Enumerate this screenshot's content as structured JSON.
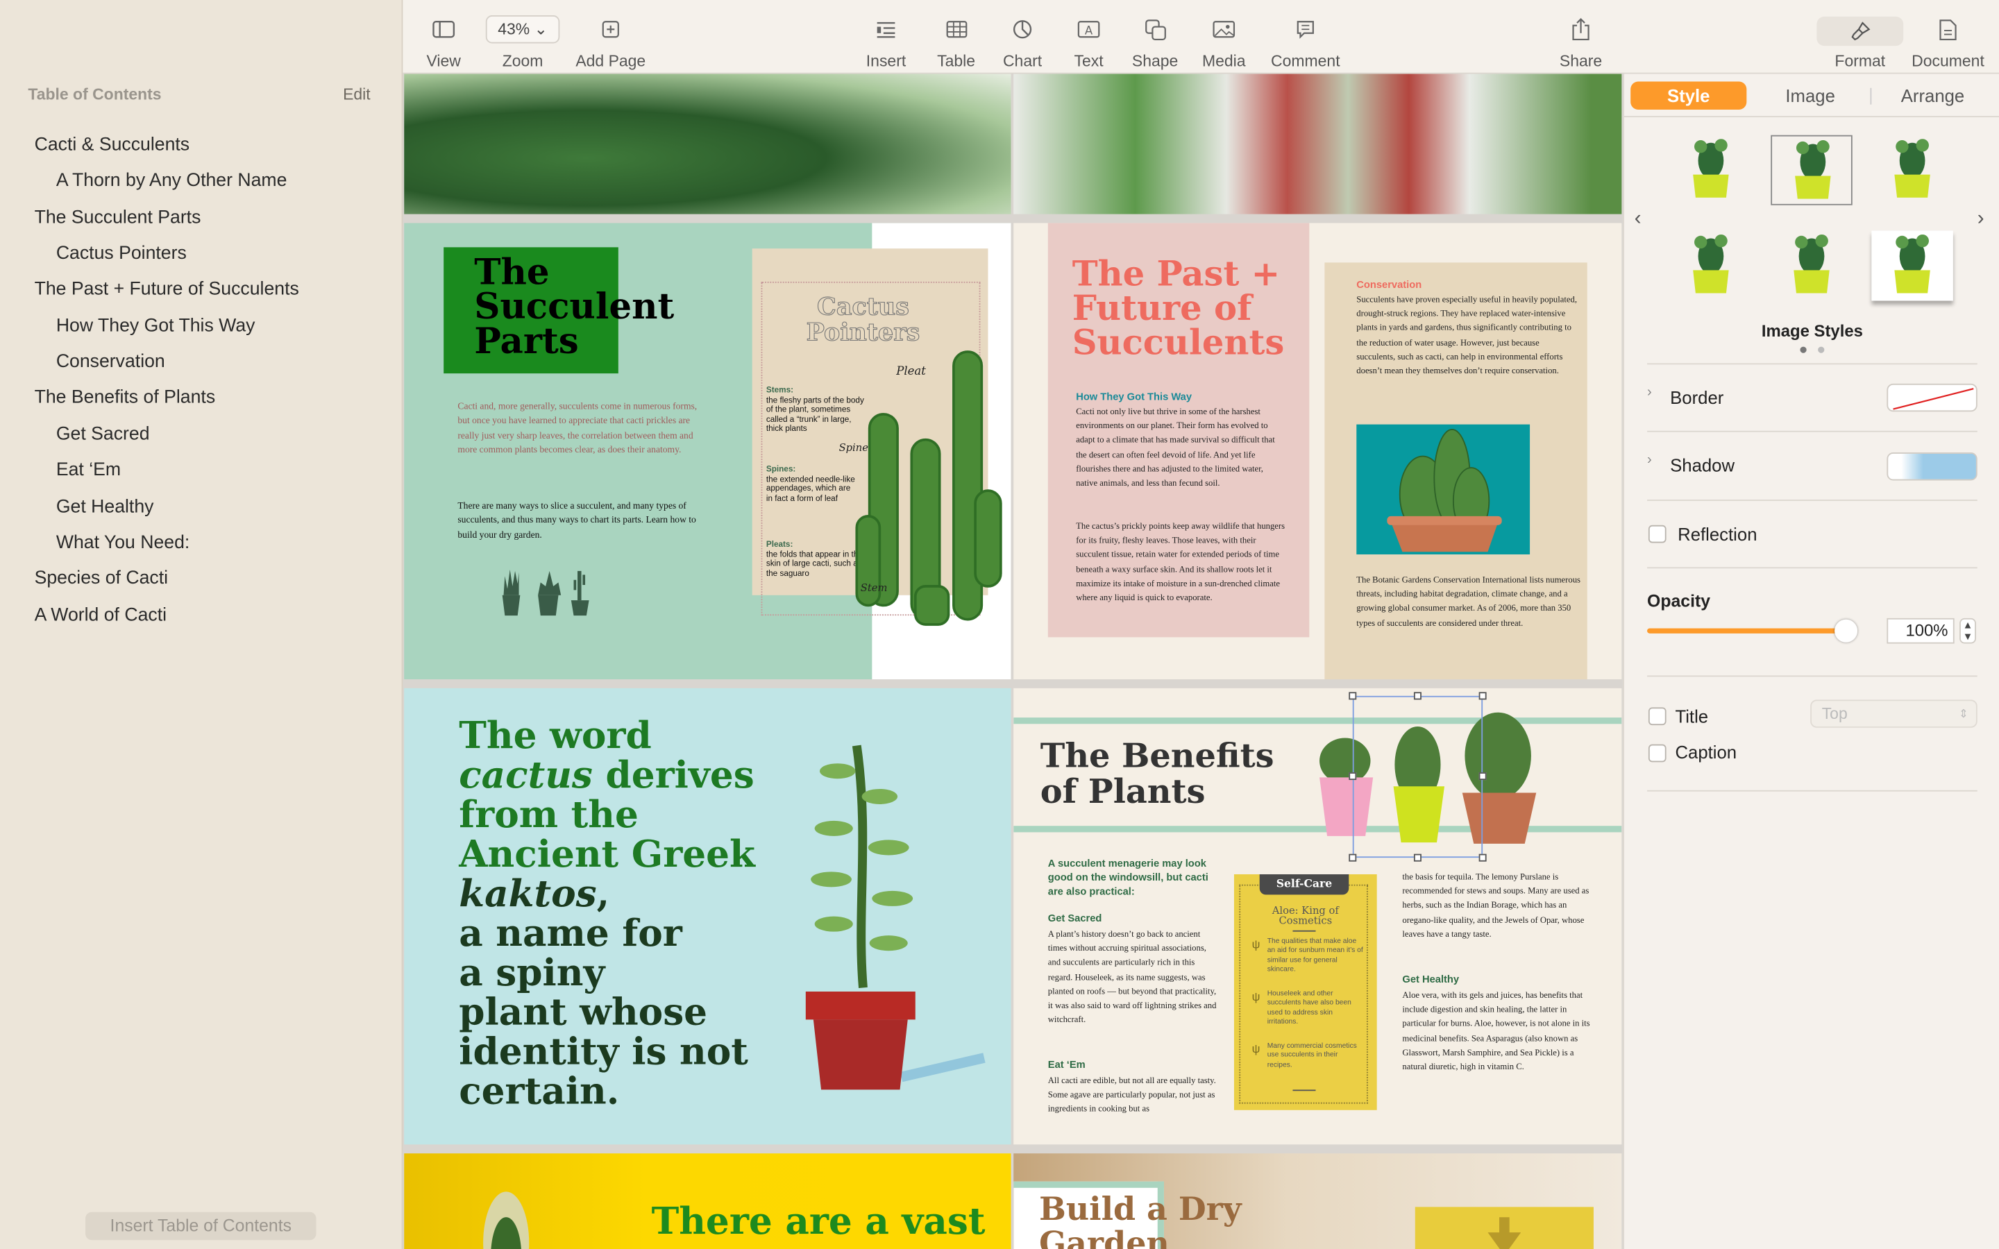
{
  "sidebar": {
    "header": "Table of Contents",
    "edit_label": "Edit",
    "items": [
      {
        "label": "Cacti & Succulents",
        "level": 1
      },
      {
        "label": "A Thorn by Any Other Name",
        "level": 2
      },
      {
        "label": "The Succulent Parts",
        "level": 1
      },
      {
        "label": "Cactus  Pointers",
        "level": 2
      },
      {
        "label": "The Past + Future of Succulents",
        "level": 1
      },
      {
        "label": "How They Got This Way",
        "level": 2
      },
      {
        "label": "Conservation",
        "level": 2
      },
      {
        "label": "The Benefits  of Plants",
        "level": 1
      },
      {
        "label": "Get Sacred",
        "level": 2
      },
      {
        "label": "Eat ‘Em",
        "level": 2
      },
      {
        "label": "Get Healthy",
        "level": 2
      },
      {
        "label": "What You Need:",
        "level": 2
      },
      {
        "label": "Species of Cacti",
        "level": 1
      },
      {
        "label": "A World of Cacti",
        "level": 1
      }
    ],
    "insert_button": "Insert Table of Contents"
  },
  "toolbar": {
    "view": "View",
    "zoom_value": "43%",
    "zoom": "Zoom",
    "add_page": "Add Page",
    "insert": "Insert",
    "table": "Table",
    "chart": "Chart",
    "text": "Text",
    "shape": "Shape",
    "media": "Media",
    "comment": "Comment",
    "share": "Share",
    "format": "Format",
    "document": "Document"
  },
  "pages": {
    "succulent_parts": {
      "title": "The Succulent Parts",
      "intro": "Cacti and, more generally, succulents come in numerous forms, but once you have learned to appreciate that cacti prickles are really just very sharp leaves, the correlation between them and more common plants becomes clear, as does their anatomy.",
      "body": "There are many ways to slice a succulent, and many types of succulents, and thus many ways to chart its parts. Learn how to build your dry garden.",
      "pointers_title": "Cactus Pointers",
      "stems_h": "Stems:",
      "stems": "the fleshy parts of the body of the plant, sometimes called a “trunk” in large, thick plants",
      "spines_h": "Spines:",
      "spines": "the extended needle-like appendages, which are in fact a form of leaf",
      "pleats_h": "Pleats:",
      "pleats": "the folds that appear in the skin of large cacti, such as the saguaro",
      "label_pleat": "Pleat",
      "label_spine": "Spine",
      "label_stem": "Stem"
    },
    "past_future": {
      "title": "The Past + Future of Succulents",
      "sub1": "How They Got This Way",
      "p1": "Cacti not only live but thrive in some of the harshest environments on our planet. Their form has evolved to adapt to a climate that has made survival so difficult that the desert can often feel devoid of life. And yet life flourishes there and has adjusted to the limited water, native animals, and less than fecund soil.",
      "p2": "The cactus’s prickly points keep away wildlife that hungers for its fruity, fleshy leaves. Those leaves, with their succulent tissue, retain water for extended periods of time beneath a waxy surface skin. And its shallow roots let it maximize its intake of moisture in a sun-drenched climate where any liquid is quick to evaporate.",
      "sub2": "Conservation",
      "p3": "Succulents have proven especially useful in heavily populated, drought-struck regions. They have replaced water-intensive plants in yards and gardens, thus significantly contributing to the reduction of water usage. However, just because succulents, such as cacti, can help in environmental efforts doesn’t mean they themselves don’t require conservation.",
      "p4": "The Botanic Gardens Conservation International lists numerous threats, including habitat degradation, climate change, and a growing global consumer market. As of 2006, more than 350 types of succulents are considered under threat."
    },
    "quote": {
      "l1": "The word",
      "l2a": "cactus",
      "l2b": " derives",
      "l3": "from the",
      "l4": "Ancient Greek",
      "l5a": "kaktos",
      "l5b": ",",
      "l6": "a name for",
      "l7": "a spiny",
      "l8": "plant whose",
      "l9": "identity is not",
      "l10": "certain."
    },
    "benefits": {
      "title": "The Benefits of Plants",
      "lead": "A succulent menagerie may look good on the windowsill, but cacti are also practical:",
      "h1": "Get Sacred",
      "p1": "A plant’s history doesn’t go back to ancient times without accruing spiritual associations, and succulents are particularly rich in this regard. Houseleek, as its name suggests, was planted on roofs — but beyond that practicality, it was also said to ward off lightning strikes and witchcraft.",
      "h2": "Eat ‘Em",
      "p2": "All cacti are edible, but not all are equally tasty. Some agave are particularly popular, not just as ingredients in cooking but as",
      "p3": "the basis for tequila. The lemony Purslane is recommended for stews and soups. Many are used as herbs, such as the Indian Borage, which has an oregano-like quality, and the Jewels of Opar, whose leaves have a tangy taste.",
      "h3": "Get Healthy",
      "p4": "Aloe vera, with its gels and juices, has benefits that include digestion and skin healing, the latter in particular for burns. Aloe, however, is not alone in its medicinal benefits. Sea Asparagus (also known as Glasswort, Marsh Samphire, and Sea Pickle) is a natural diuretic, high in vitamin C.",
      "box_tab": "Self-Care",
      "box_title": "Aloe: King of Cosmetics",
      "box_items": [
        "The qualities that make aloe an aid for sunburn mean it’s of similar use for general skincare.",
        "Houseleek and other succulents have also been used to address skin irritations.",
        "Many commercial cosmetics use succulents in their recipes."
      ]
    },
    "vast": {
      "title": "There are a vast"
    },
    "dry_garden": {
      "title": "Build a Dry Garden"
    }
  },
  "inspector": {
    "tabs": [
      "Style",
      "Image",
      "Arrange"
    ],
    "active_tab": "Style",
    "accent": "#fd9a2a",
    "image_styles_label": "Image Styles",
    "style_page": 1,
    "style_pages": 2,
    "border_label": "Border",
    "shadow_label": "Shadow",
    "reflection_label": "Reflection",
    "reflection_checked": false,
    "opacity_label": "Opacity",
    "opacity_value": "100%",
    "opacity_fraction": 1.0,
    "title_label": "Title",
    "title_checked": false,
    "title_position": "Top",
    "caption_label": "Caption",
    "caption_checked": false
  }
}
